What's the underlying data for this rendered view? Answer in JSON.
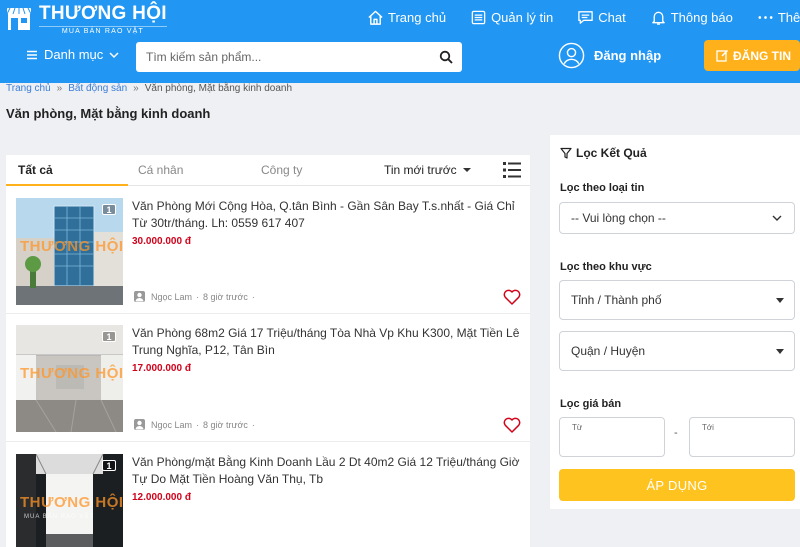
{
  "brand": {
    "name": "THƯƠNG HỘI",
    "tagline": "MUA BÁN RAO VẶT"
  },
  "topnav": [
    {
      "label": "Trang chủ",
      "icon": "home-icon"
    },
    {
      "label": "Quản lý tin",
      "icon": "list-icon"
    },
    {
      "label": "Chat",
      "icon": "chat-icon"
    },
    {
      "label": "Thông báo",
      "icon": "bell-icon"
    },
    {
      "label": "Thêm",
      "icon": "more-icon"
    }
  ],
  "header": {
    "category_label": "Danh mục",
    "search_placeholder": "Tìm kiếm sản phẩm...",
    "login_label": "Đăng nhập",
    "post_label": "ĐĂNG TIN"
  },
  "breadcrumb": [
    "Trang chủ",
    "Bất động sản",
    "Văn phòng, Mặt bằng kinh doanh"
  ],
  "page_title": "Văn phòng, Mặt bằng kinh doanh",
  "tabs": [
    "Tất cả",
    "Cá nhân",
    "Công ty"
  ],
  "sort_label": "Tin mới trước",
  "listings": [
    {
      "title": "Văn Phòng Mới Cộng Hòa, Q.tân Bình - Gần Sân Bay T.s.nhất - Giá Chỉ Từ 30tr/tháng. Lh: 0559 617 407",
      "price": "30.000.000 đ",
      "seller": "Ngọc Lam",
      "time": "8 giờ trước",
      "image_count": "1"
    },
    {
      "title": "Văn Phòng 68m2 Giá 17 Triệu/tháng Tòa Nhà Vp Khu K300, Mặt Tiền Lê Trung Nghĩa, P12, Tân Bìn",
      "price": "17.000.000 đ",
      "seller": "Ngọc Lam",
      "time": "8 giờ trước",
      "image_count": "1"
    },
    {
      "title": "Văn Phòng/mặt Bằng Kinh Doanh Lầu 2 Dt 40m2 Giá 12 Triệu/tháng Giờ Tự Do Mặt Tiền Hoàng Văn Thụ, Tb",
      "price": "12.000.000 đ",
      "seller": "",
      "time": "",
      "image_count": "1"
    }
  ],
  "watermark": {
    "main": "THƯƠNG HỘI",
    "sub": "MUA BÁN RAO VẶT"
  },
  "filter": {
    "title": "Lọc Kết Quả",
    "type_label": "Lọc theo loại tin",
    "type_value": "-- Vui lòng chọn --",
    "area_label": "Lọc theo khu vực",
    "province_placeholder": "Tỉnh / Thành phố",
    "district_placeholder": "Quận / Huyện",
    "price_label": "Lọc giá bán",
    "from_placeholder": "Từ",
    "to_placeholder": "Tới",
    "dash": "-",
    "apply_label": "ÁP DỤNG"
  },
  "colors": {
    "primary": "#2196f3",
    "accent": "#ffb11b",
    "price": "#d0021b"
  }
}
